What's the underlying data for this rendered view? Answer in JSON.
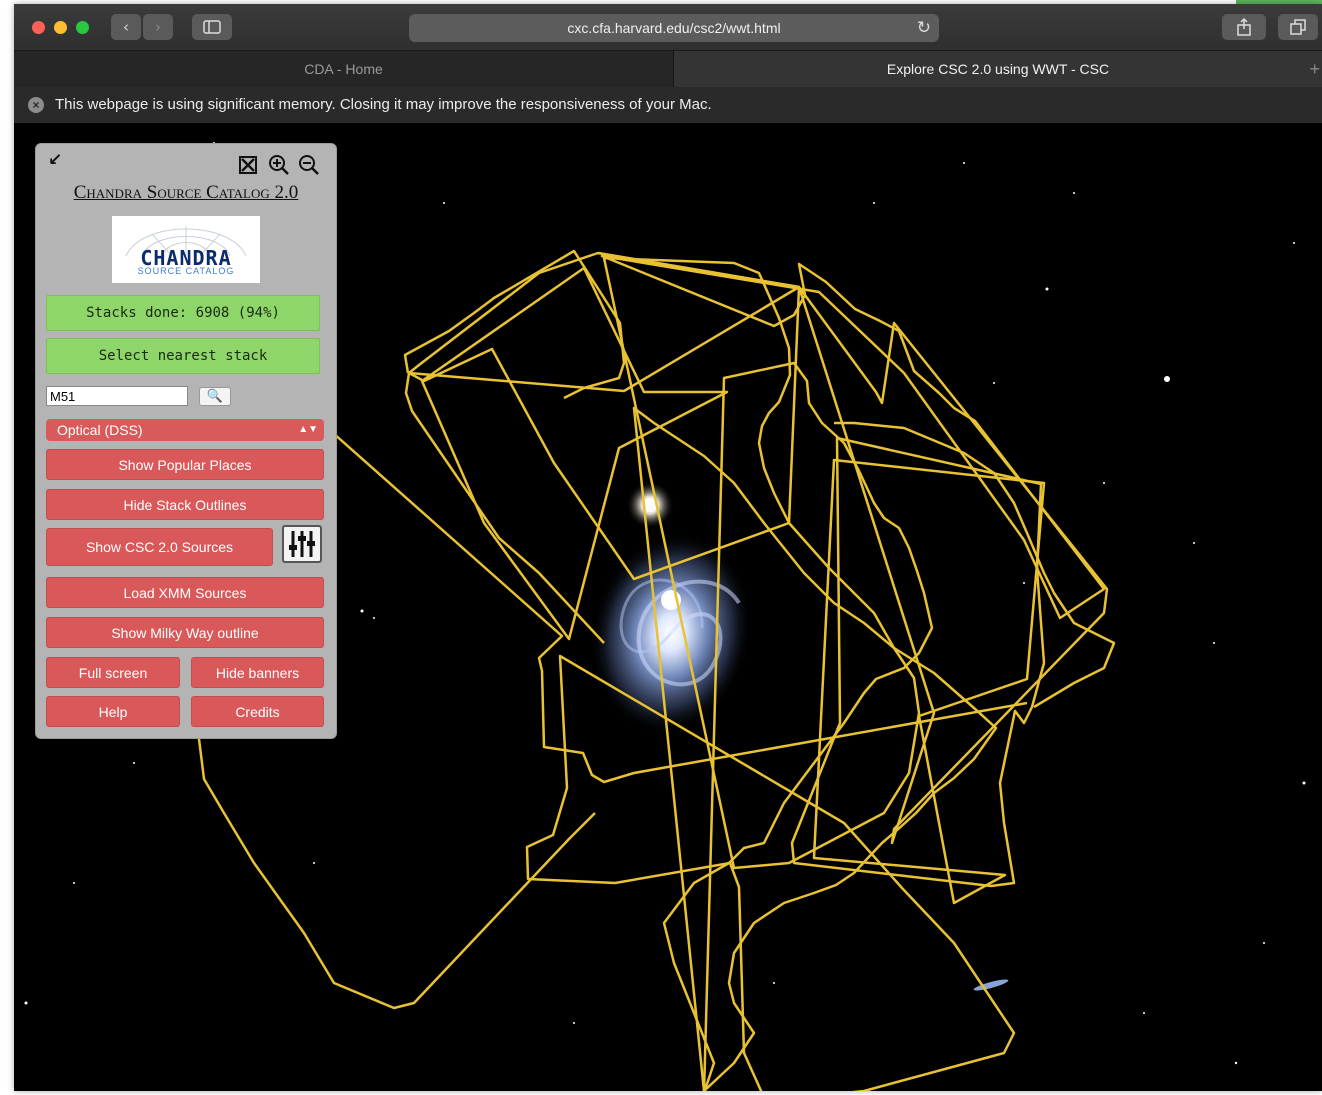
{
  "browser": {
    "url": "cxc.cfa.harvard.edu/csc2/wwt.html",
    "tabs": [
      {
        "label": "CDA - Home",
        "active": false
      },
      {
        "label": "Explore CSC 2.0 using WWT - CSC",
        "active": true
      }
    ],
    "new_tab_label": "+",
    "memory_warning": "This webpage is using significant memory. Closing it may improve the responsiveness of your Mac."
  },
  "panel": {
    "title": "Chandra Source Catalog 2.0",
    "logo_word": "CHANDRA",
    "logo_sub": "SOURCE CATALOG",
    "stacks_done": "Stacks done: 6908 (94%)",
    "select_nearest": "Select nearest stack",
    "search_value": "M51",
    "layer_selected": "Optical (DSS)",
    "buttons": {
      "popular_places": "Show Popular Places",
      "hide_outlines": "Hide Stack Outlines",
      "show_sources": "Show CSC 2.0 Sources",
      "load_xmm": "Load XMM Sources",
      "milky_way": "Show Milky Way outline",
      "full_screen": "Full screen",
      "hide_banners": "Hide banners",
      "help": "Help",
      "credits": "Credits"
    }
  },
  "colors": {
    "outline": "#e8c233",
    "green_button": "#8fd66a",
    "red_button": "#d9595a",
    "panel_bg": "#b4b4b4",
    "sky": "#000000"
  },
  "icons": [
    "close-circle-icon",
    "back-icon",
    "forward-icon",
    "sidebar-icon",
    "reload-icon",
    "share-icon",
    "tabs-overview-icon",
    "collapse-icon",
    "fit-view-icon",
    "zoom-in-icon",
    "zoom-out-icon",
    "search-icon",
    "sliders-icon"
  ]
}
